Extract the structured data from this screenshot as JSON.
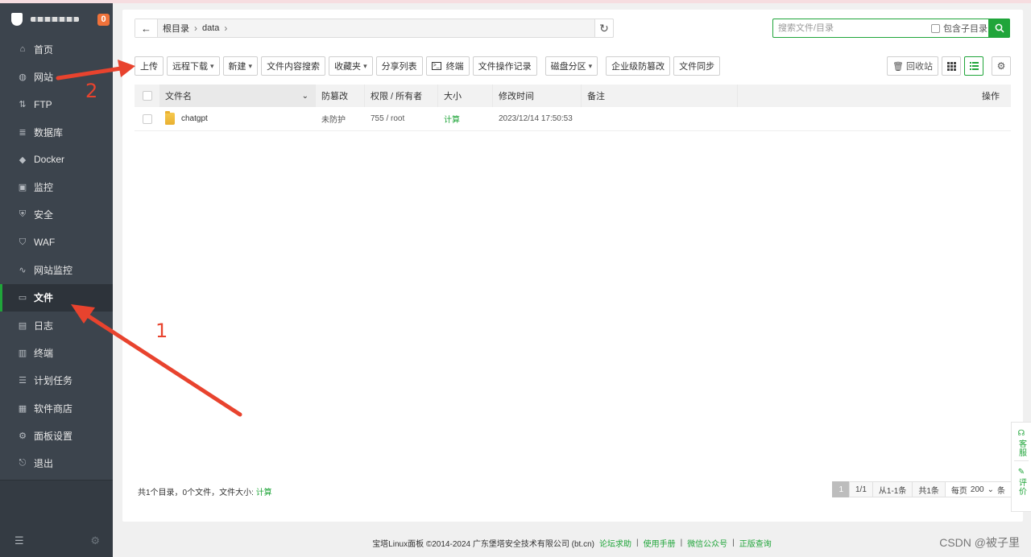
{
  "sidebar": {
    "badge": "0",
    "items": [
      {
        "label": "首页",
        "icon": "home-icon",
        "glyph": "⌂"
      },
      {
        "label": "网站",
        "icon": "globe-icon",
        "glyph": "◍"
      },
      {
        "label": "FTP",
        "icon": "ftp-icon",
        "glyph": "⇅"
      },
      {
        "label": "数据库",
        "icon": "database-icon",
        "glyph": "≣"
      },
      {
        "label": "Docker",
        "icon": "docker-icon",
        "glyph": "◆"
      },
      {
        "label": "监控",
        "icon": "monitor-icon",
        "glyph": "▣"
      },
      {
        "label": "安全",
        "icon": "shield-icon",
        "glyph": "⛨"
      },
      {
        "label": "WAF",
        "icon": "waf-icon",
        "glyph": "⛉"
      },
      {
        "label": "网站监控",
        "icon": "chart-icon",
        "glyph": "∿"
      },
      {
        "label": "文件",
        "icon": "folder-icon",
        "glyph": "▭"
      },
      {
        "label": "日志",
        "icon": "log-icon",
        "glyph": "▤"
      },
      {
        "label": "终端",
        "icon": "terminal-icon",
        "glyph": "▥"
      },
      {
        "label": "计划任务",
        "icon": "task-icon",
        "glyph": "☰"
      },
      {
        "label": "软件商店",
        "icon": "store-icon",
        "glyph": "▦"
      },
      {
        "label": "面板设置",
        "icon": "settings-icon",
        "glyph": "⚙"
      },
      {
        "label": "退出",
        "icon": "logout-icon",
        "glyph": "⎋"
      }
    ]
  },
  "pathbar": {
    "root": "根目录",
    "current": "data"
  },
  "search": {
    "placeholder": "搜索文件/目录",
    "include_sub": "包含子目录"
  },
  "toolbar": {
    "upload": "上传",
    "remote_download": "远程下载",
    "new": "新建",
    "content_search": "文件内容搜索",
    "favorites": "收藏夹",
    "share_list": "分享列表",
    "terminal": "终端",
    "op_log": "文件操作记录",
    "disk_partition": "磁盘分区",
    "tamper_proof": "企业级防篡改",
    "file_sync": "文件同步",
    "recycle_bin": "回收站"
  },
  "table": {
    "headers": {
      "name": "文件名",
      "protect": "防篡改",
      "perm": "权限 / 所有者",
      "size": "大小",
      "mtime": "修改时间",
      "note": "备注",
      "ops": "操作"
    },
    "rows": [
      {
        "name": "chatgpt",
        "protect": "未防护",
        "perm": "755 / root",
        "size": "计算",
        "mtime": "2023/12/14 17:50:53",
        "note": ""
      }
    ]
  },
  "summary": {
    "text": "共1个目录，0个文件，文件大小:",
    "calc": "计算"
  },
  "pager": {
    "current": "1",
    "pages": "1/1",
    "range": "从1-1条",
    "total": "共1条",
    "per_page_label": "每页",
    "per_page": "200",
    "unit": "条"
  },
  "footer": {
    "copyright": "宝塔Linux面板 ©2014-2024 广东堡塔安全技术有限公司 (bt.cn)",
    "links": [
      "论坛求助",
      "使用手册",
      "微信公众号",
      "正版查询"
    ],
    "sep": "|"
  },
  "side_help": {
    "service": "客服",
    "review": "评价"
  },
  "watermark": "CSDN @被子里",
  "annotations": {
    "one": "1",
    "two": "2"
  },
  "colors": {
    "accent": "#20a53a",
    "sidebar": "#3c444d",
    "annotation": "#e8432e"
  }
}
